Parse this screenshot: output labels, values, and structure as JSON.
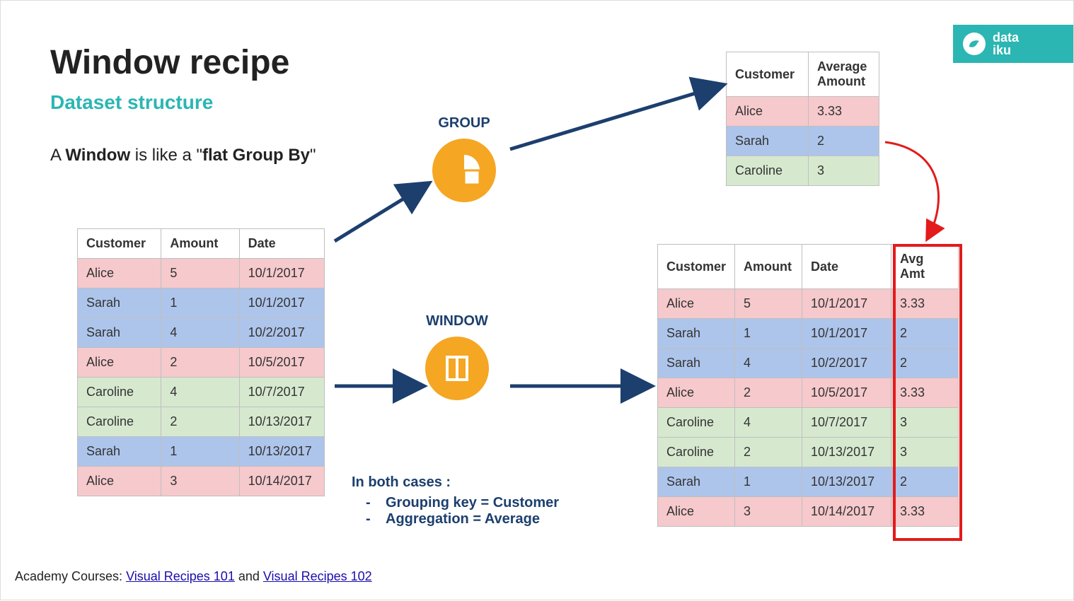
{
  "title": "Window recipe",
  "subtitle": "Dataset structure",
  "sentence_pre": "A ",
  "sentence_b1": "Window",
  "sentence_mid": " is like a \"",
  "sentence_b2": "flat Group By",
  "sentence_post": "\"",
  "op_group_label": "GROUP",
  "op_window_label": "WINDOW",
  "notes_header": "In both cases :",
  "notes_line1": "Grouping key = Customer",
  "notes_line2": "Aggregation = Average",
  "footer_pre": "Academy Courses: ",
  "footer_link1": "Visual Recipes 101",
  "footer_mid": " and ",
  "footer_link2": "Visual Recipes 102",
  "logo_line1": "data",
  "logo_line2": "iku",
  "source_table": {
    "headers": [
      "Customer",
      "Amount",
      "Date"
    ],
    "rows": [
      {
        "c": "Alice",
        "a": "5",
        "d": "10/1/2017",
        "cls": "pink"
      },
      {
        "c": "Sarah",
        "a": "1",
        "d": "10/1/2017",
        "cls": "blue"
      },
      {
        "c": "Sarah",
        "a": "4",
        "d": "10/2/2017",
        "cls": "blue"
      },
      {
        "c": "Alice",
        "a": "2",
        "d": "10/5/2017",
        "cls": "pink"
      },
      {
        "c": "Caroline",
        "a": "4",
        "d": "10/7/2017",
        "cls": "green"
      },
      {
        "c": "Caroline",
        "a": "2",
        "d": "10/13/2017",
        "cls": "green"
      },
      {
        "c": "Sarah",
        "a": "1",
        "d": "10/13/2017",
        "cls": "blue"
      },
      {
        "c": "Alice",
        "a": "3",
        "d": "10/14/2017",
        "cls": "pink"
      }
    ]
  },
  "group_table": {
    "headers": [
      "Customer",
      "Average Amount"
    ],
    "rows": [
      {
        "c": "Alice",
        "v": "3.33",
        "cls": "pink"
      },
      {
        "c": "Sarah",
        "v": "2",
        "cls": "blue"
      },
      {
        "c": "Caroline",
        "v": "3",
        "cls": "green"
      }
    ]
  },
  "window_table": {
    "headers": [
      "Customer",
      "Amount",
      "Date",
      "Avg Amt"
    ],
    "rows": [
      {
        "c": "Alice",
        "a": "5",
        "d": "10/1/2017",
        "v": "3.33",
        "cls": "pink"
      },
      {
        "c": "Sarah",
        "a": "1",
        "d": "10/1/2017",
        "v": "2",
        "cls": "blue"
      },
      {
        "c": "Sarah",
        "a": "4",
        "d": "10/2/2017",
        "v": "2",
        "cls": "blue"
      },
      {
        "c": "Alice",
        "a": "2",
        "d": "10/5/2017",
        "v": "3.33",
        "cls": "pink"
      },
      {
        "c": "Caroline",
        "a": "4",
        "d": "10/7/2017",
        "v": "3",
        "cls": "green"
      },
      {
        "c": "Caroline",
        "a": "2",
        "d": "10/13/2017",
        "v": "3",
        "cls": "green"
      },
      {
        "c": "Sarah",
        "a": "1",
        "d": "10/13/2017",
        "v": "2",
        "cls": "blue"
      },
      {
        "c": "Alice",
        "a": "3",
        "d": "10/14/2017",
        "v": "3.33",
        "cls": "pink"
      }
    ]
  }
}
